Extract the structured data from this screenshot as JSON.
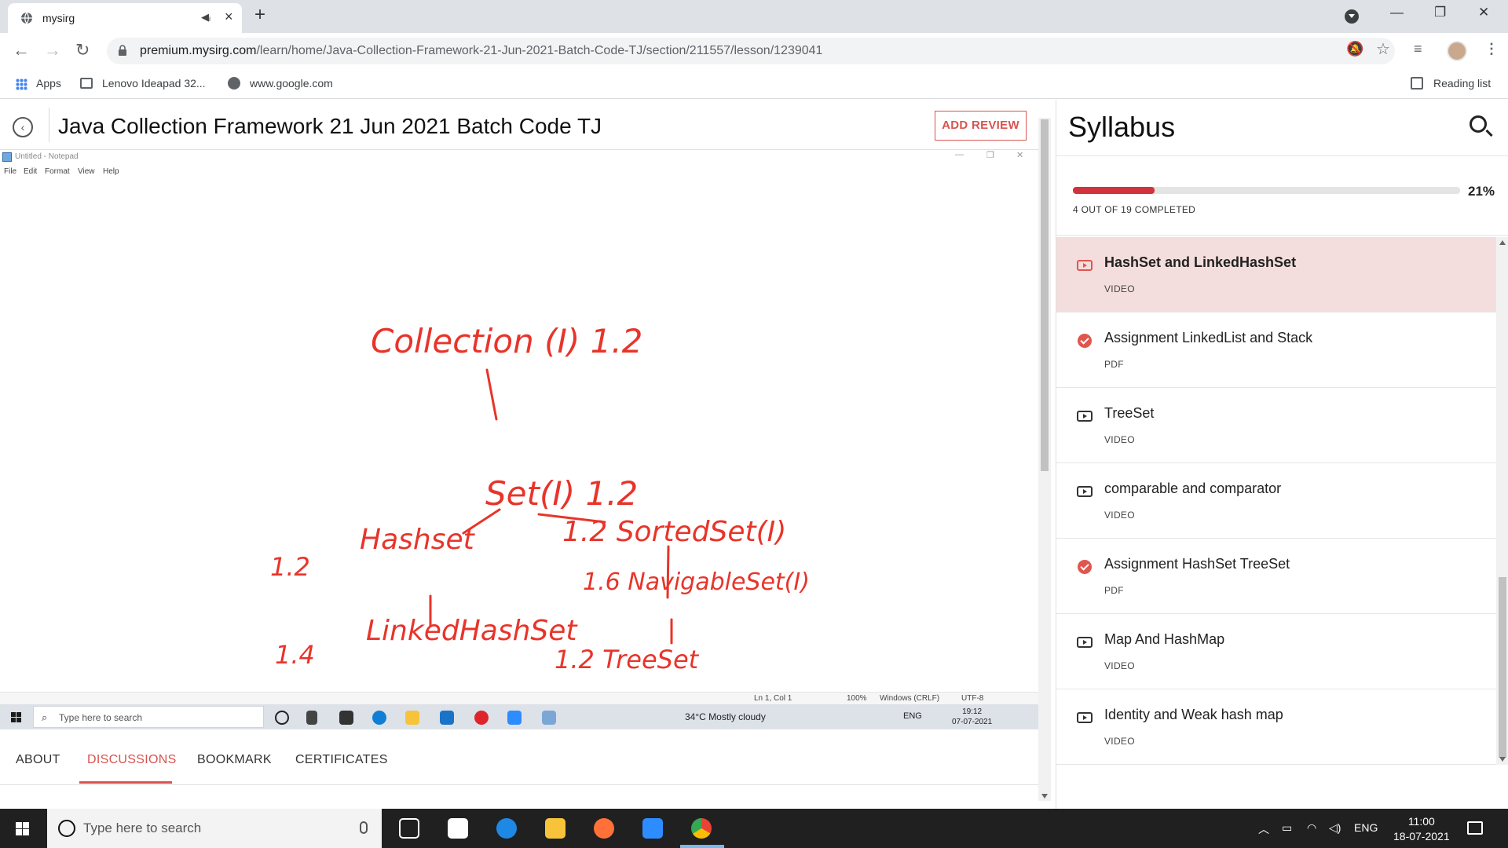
{
  "browser": {
    "tab_title": "mysirg",
    "url_host": "premium.mysirg.com",
    "url_path": "/learn/home/Java-Collection-Framework-21-Jun-2021-Batch-Code-TJ/section/211557/lesson/1239041",
    "bookmarks": [
      {
        "label": "Apps",
        "icon": "apps-grid-icon"
      },
      {
        "label": "Lenovo Ideapad 32...",
        "icon": "laptop-icon"
      },
      {
        "label": "www.google.com",
        "icon": "globe-icon"
      }
    ],
    "reading_list": "Reading list"
  },
  "course": {
    "title": "Java Collection Framework 21 Jun 2021 Batch Code TJ",
    "add_review": "ADD REVIEW"
  },
  "video": {
    "notepad_title": "Untitled - Notepad",
    "menu": [
      "File",
      "Edit",
      "Format",
      "View",
      "Help"
    ],
    "handwriting": {
      "collection": "Collection (I) 1.2",
      "set": "Set(I) 1.2",
      "sortedset": "1.2 SortedSet(I)",
      "hashset": "Hashset",
      "hashset_ver": "1.2",
      "navigable": "1.6 NavigableSet(I)",
      "linkedhashset": "LinkedHashSet",
      "linkedhashset_ver": "1.4",
      "treeset": "1.2 TreeSet"
    },
    "status_bar": {
      "position": "Ln 1, Col 1",
      "zoom": "100%",
      "line_ending": "Windows (CRLF)",
      "encoding": "UTF-8"
    },
    "inner_taskbar": {
      "search_placeholder": "Type here to search",
      "weather": "34°C  Mostly cloudy",
      "lang": "ENG",
      "time": "19:12",
      "date": "07-07-2021"
    }
  },
  "lower_tabs": [
    "ABOUT",
    "DISCUSSIONS",
    "BOOKMARK",
    "CERTIFICATES"
  ],
  "active_lower_tab": "DISCUSSIONS",
  "syllabus": {
    "title": "Syllabus",
    "progress_fraction": 0.21,
    "progress_pct": "21%",
    "progress_text": "4 OUT OF 19 COMPLETED",
    "lessons": [
      {
        "title": "HashSet and LinkedHashSet",
        "type": "VIDEO",
        "icon": "play-icon",
        "active": true
      },
      {
        "title": "Assignment LinkedList and Stack",
        "type": "PDF",
        "icon": "check-icon",
        "active": false
      },
      {
        "title": "TreeSet",
        "type": "VIDEO",
        "icon": "play-icon",
        "active": false
      },
      {
        "title": "comparable and comparator",
        "type": "VIDEO",
        "icon": "play-icon",
        "active": false
      },
      {
        "title": "Assignment HashSet TreeSet",
        "type": "PDF",
        "icon": "check-icon",
        "active": false
      },
      {
        "title": "Map And HashMap",
        "type": "VIDEO",
        "icon": "play-icon",
        "active": false
      },
      {
        "title": "Identity and Weak hash map",
        "type": "VIDEO",
        "icon": "play-icon",
        "active": false
      }
    ]
  },
  "taskbar": {
    "search_placeholder": "Type here to search",
    "lang": "ENG",
    "time": "11:00",
    "date": "18-07-2021"
  },
  "colors": {
    "accent": "#d9534f",
    "progress": "#d2323c",
    "active_lesson_bg": "#f4dedd",
    "ink": "#e8342a"
  }
}
